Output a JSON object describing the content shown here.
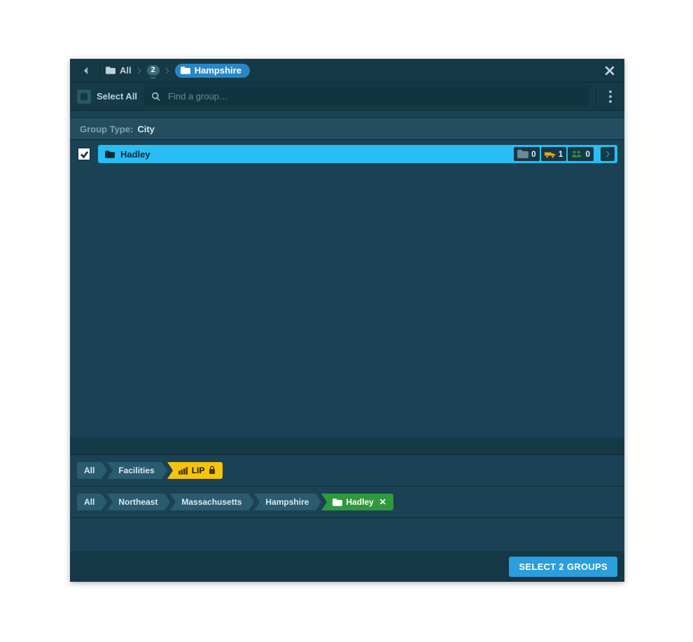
{
  "breadcrumb": {
    "root": "All",
    "hidden_count": "2",
    "current": "Hampshire"
  },
  "toolbar": {
    "select_all_label": "Select All",
    "search_placeholder": "Find a group…"
  },
  "group_header": {
    "label": "Group Type:",
    "value": "City"
  },
  "rows": [
    {
      "name": "Hadley",
      "folders": "0",
      "vehicles": "1",
      "people": "0"
    }
  ],
  "chips_top": {
    "all": "All",
    "facilities": "Facilities",
    "lip": "LIP"
  },
  "chips_bottom": {
    "all": "All",
    "northeast": "Northeast",
    "massachusetts": "Massachusetts",
    "hampshire": "Hampshire",
    "hadley": "Hadley"
  },
  "footer": {
    "button_label": "SELECT 2 GROUPS"
  }
}
